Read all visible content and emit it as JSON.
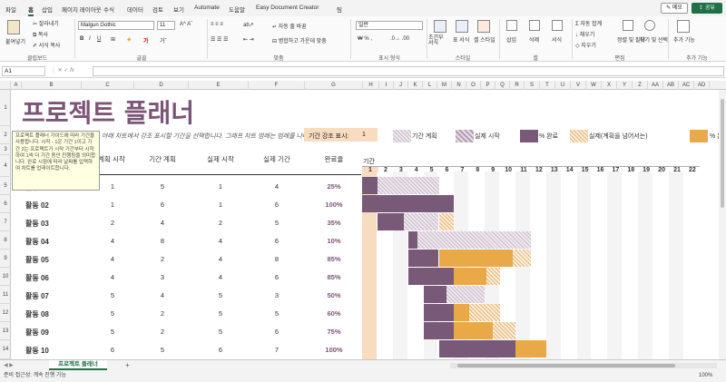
{
  "menubar": {
    "items": [
      "파일",
      "홈",
      "삽입",
      "페이지 레이아웃",
      "수식",
      "데이터",
      "검토",
      "보기",
      "Automate",
      "도움말",
      "Easy Document Creator",
      "팀"
    ],
    "active_index": 1,
    "memo_label": "메모",
    "share_label": "공유"
  },
  "ribbon": {
    "groups": [
      "클립보드",
      "글꼴",
      "맞춤",
      "표시 형식",
      "스타일",
      "셀",
      "편집",
      "추가 기능"
    ],
    "paste_label": "붙여넣기",
    "cut_label": "잘라내기",
    "copy_label": "복사",
    "format_painter_label": "서식 복사",
    "font_name": "Malgun Gothic",
    "font_size": "11",
    "wrap_label": "자동 줄 바꿈",
    "merge_label": "병합하고 가운데 맞춤",
    "number_format": "일반",
    "style_items": [
      "조건부 서식",
      "표 서식",
      "셀 스타일"
    ],
    "cell_items": [
      "삽입",
      "삭제",
      "서식"
    ],
    "edit_items": [
      "자동 합계",
      "채우기",
      "지우기",
      "정렬 및 필터",
      "찾기 및 선택"
    ],
    "addin_label": "추가 기능"
  },
  "formula_bar": {
    "name_box": "A1",
    "formula": ""
  },
  "columns": [
    "A",
    "B",
    "C",
    "D",
    "E",
    "F",
    "G",
    "H",
    "I",
    "J",
    "K",
    "L",
    "M",
    "N",
    "O",
    "P",
    "Q",
    "R",
    "S",
    "T",
    "U",
    "V",
    "W",
    "X",
    "Y",
    "Z",
    "AA",
    "AB",
    "AC",
    "AD"
  ],
  "rows": [
    "1",
    "2",
    "3",
    "4",
    "5",
    "6",
    "7",
    "8",
    "9",
    "10",
    "11",
    "12",
    "13",
    "14"
  ],
  "sheet": {
    "title": "프로젝트 플래너",
    "subtitle": "아래 차트에서 강조 표시할 기간을 선택합니다. 그래프 차트 범례는 범례를 나타냅니다.",
    "period_label": "기간 강조 표시:",
    "period_value": "1",
    "legend": [
      "기간 계획",
      "실제 시작",
      "% 완료",
      "실제(계획을 넘어서는)",
      "% 완료(계획을 넘어서는)"
    ],
    "headers": {
      "activity": "활동",
      "plan_start": "계획 시작",
      "plan_duration": "기간 계획",
      "actual_start": "실제 시작",
      "actual_duration": "실제 기간",
      "percent_complete": "완료율",
      "period": "기간"
    },
    "periods": [
      "1",
      "2",
      "3",
      "4",
      "5",
      "6",
      "7",
      "8",
      "9",
      "10",
      "11",
      "12",
      "13",
      "14",
      "15",
      "16",
      "17",
      "18",
      "19",
      "20",
      "21",
      "22"
    ],
    "tooltip": "프로젝트 플래너 가이드에 따라 기간을 사용합니다. 시작 - 1은 기간 1이고 기간 2는 프로젝트가 시작 기간부터 시작하여 1씩 더 기간 동안 진행됨을 의미합니다. 완료 시점에 따라 날짜를 입력하여 차트를 업데이트합니다."
  },
  "tasks": [
    {
      "name": "활동 01",
      "plan_start": 1,
      "plan_dur": 5,
      "act_start": 1,
      "act_dur": 4,
      "pct": "25%",
      "pct_value": 0.25
    },
    {
      "name": "활동 02",
      "plan_start": 1,
      "plan_dur": 6,
      "act_start": 1,
      "act_dur": 6,
      "pct": "100%",
      "pct_value": 1.0
    },
    {
      "name": "활동 03",
      "plan_start": 2,
      "plan_dur": 4,
      "act_start": 2,
      "act_dur": 5,
      "pct": "35%",
      "pct_value": 0.35
    },
    {
      "name": "활동 04",
      "plan_start": 4,
      "plan_dur": 8,
      "act_start": 4,
      "act_dur": 6,
      "pct": "10%",
      "pct_value": 0.1
    },
    {
      "name": "활동 05",
      "plan_start": 4,
      "plan_dur": 2,
      "act_start": 4,
      "act_dur": 8,
      "pct": "85%",
      "pct_value": 0.85
    },
    {
      "name": "활동 06",
      "plan_start": 4,
      "plan_dur": 3,
      "act_start": 4,
      "act_dur": 6,
      "pct": "85%",
      "pct_value": 0.85
    },
    {
      "name": "활동 07",
      "plan_start": 5,
      "plan_dur": 4,
      "act_start": 5,
      "act_dur": 3,
      "pct": "50%",
      "pct_value": 0.5
    },
    {
      "name": "활동 08",
      "plan_start": 5,
      "plan_dur": 2,
      "act_start": 5,
      "act_dur": 5,
      "pct": "60%",
      "pct_value": 0.6
    },
    {
      "name": "활동 09",
      "plan_start": 5,
      "plan_dur": 2,
      "act_start": 5,
      "act_dur": 6,
      "pct": "75%",
      "pct_value": 0.75
    },
    {
      "name": "활동 10",
      "plan_start": 6,
      "plan_dur": 5,
      "act_start": 6,
      "act_dur": 7,
      "pct": "100%",
      "pct_value": 1.0
    }
  ],
  "sheet_tabs": {
    "active": "프로젝트 플래너",
    "add_label": "+"
  },
  "status": {
    "left": "준비  접근성: 계속 진행 가능",
    "zoom": "100%"
  },
  "colors": {
    "accent": "#7b5577",
    "actual": "#785a78",
    "over": "#e9a948",
    "highlight": "#f7dcbf",
    "excel_green": "#217346"
  }
}
